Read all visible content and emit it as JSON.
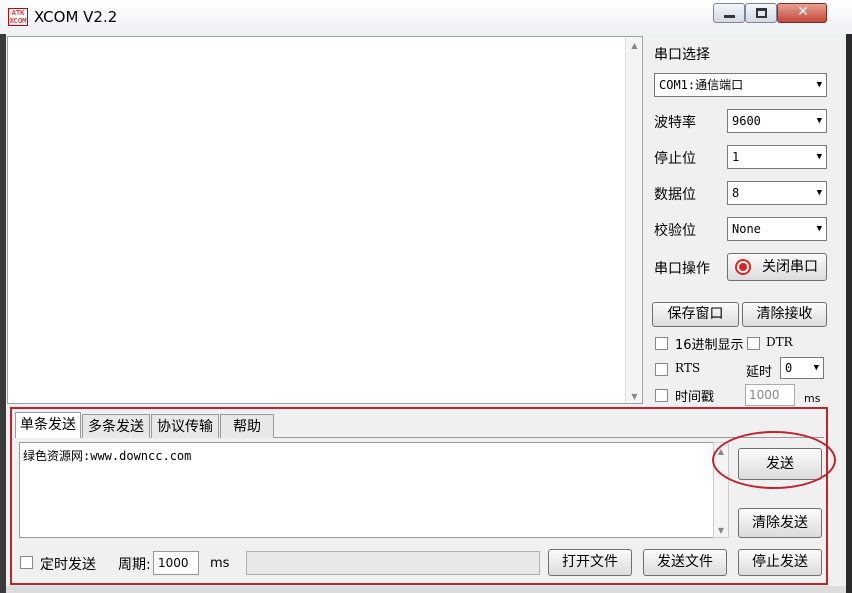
{
  "window": {
    "title": "XCOM V2.2",
    "logo_text": "ATK\nXCOM",
    "minimize_label": "▬",
    "maximize_label": "▢",
    "close_label": "✕"
  },
  "serial": {
    "port_label": "串口选择",
    "port_value": "COM1:通信端口",
    "baud_label": "波特率",
    "baud_value": "9600",
    "stop_label": "停止位",
    "stop_value": "1",
    "data_label": "数据位",
    "data_value": "8",
    "parity_label": "校验位",
    "parity_value": "None",
    "op_label": "串口操作",
    "close_port_label": "关闭串口"
  },
  "actions": {
    "save_window": "保存窗口",
    "clear_receive": "清除接收",
    "hex_display": "16进制显示",
    "dtr": "DTR",
    "rts": "RTS",
    "delay_label": "延时",
    "delay_value": "0",
    "timestamp": "时间戳",
    "timestamp_value": "1000",
    "timestamp_unit": "ms"
  },
  "tabs": [
    "单条发送",
    "多条发送",
    "协议传输",
    "帮助"
  ],
  "send": {
    "text": "绿色资源网:www.downcc.com",
    "send_button": "发送",
    "clear_send_button": "清除发送",
    "timed_send_label": "定时发送",
    "period_label": "周期:",
    "period_value": "1000",
    "period_unit": "ms",
    "open_file": "打开文件",
    "send_file": "发送文件",
    "stop_send": "停止发送"
  },
  "colors": {
    "annotation_red": "#c0252c",
    "indicator_red": "#e02020"
  }
}
